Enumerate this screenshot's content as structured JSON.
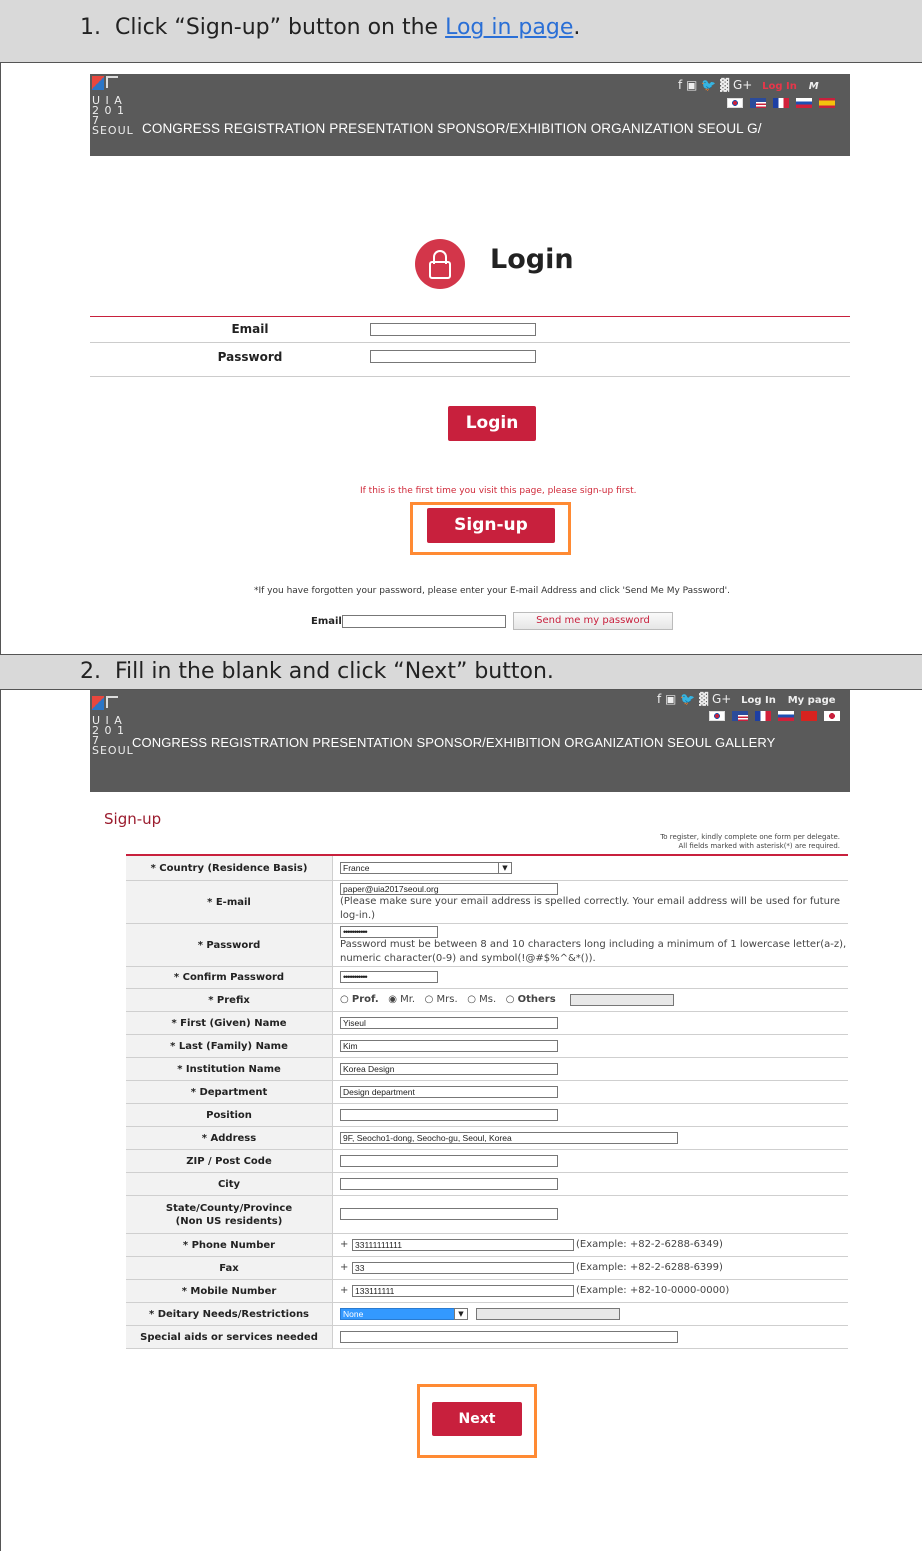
{
  "step1": {
    "number": "1.",
    "text": "Click “Sign-up” button on the ",
    "link": "Log in page",
    "end": "."
  },
  "step2": {
    "number": "2.",
    "text": "Fill in the blank and click “Next” button."
  },
  "site": {
    "logo_line1": "U I A",
    "logo_line2": "2 0 1 7",
    "logo_line3": "SEOUL",
    "nav1": "CONGRESS  REGISTRATION  PRESENTATION  SPONSOR/EXHIBITION  ORGANIZATION  SEOUL  G/",
    "nav2": "CONGRESS  REGISTRATION  PRESENTATION  SPONSOR/EXHIBITION  ORGANIZATION  SEOUL  GALLERY",
    "social1": "f  ▣  🐦  ▓  G+",
    "login_link1": "Log In",
    "mypage_trunc": "M",
    "social2": "f  ▣  🐦  ▓  G+",
    "login_link2": "Log In",
    "mypage2": "My page"
  },
  "login": {
    "title": "Login",
    "email_label": "Email",
    "password_label": "Password",
    "login_button": "Login",
    "first_time_note": "If this is the first time you visit this page, please sign-up first.",
    "signup_button": "Sign-up",
    "forgot_note": "*If you have forgotten your password, please enter your E-mail Address and click 'Send Me My Password'.",
    "forgot_email_label": "Email",
    "send_button": "Send me my password"
  },
  "signup": {
    "title": "Sign-up",
    "note1": "To register, kindly complete one form per delegate.",
    "note2": "All fields marked with asterisk(*) are required.",
    "rows": {
      "country": {
        "label": "* Country (Residence Basis)",
        "value": "France"
      },
      "email": {
        "label": "* E-mail",
        "value": "paper@uia2017seoul.org",
        "help": "(Please make sure your email address is spelled correctly. Your email address will be used for future log-in.)"
      },
      "password": {
        "label": "* Password",
        "value": "•••••••••••",
        "help": "Password must be between 8 and 10 characters long including a minimum of 1 lowercase letter(a-z), numeric character(0-9) and symbol(!@#$%^&*())."
      },
      "confirm": {
        "label": "* Confirm Password",
        "value": "•••••••••••"
      },
      "prefix": {
        "label": "* Prefix",
        "options": [
          "Prof.",
          "Mr.",
          "Mrs.",
          "Ms.",
          "Others"
        ],
        "selected": "Mr."
      },
      "first": {
        "label": "* First (Given) Name",
        "value": "Yiseul"
      },
      "last": {
        "label": "* Last (Family) Name",
        "value": "Kim"
      },
      "institution": {
        "label": "* Institution Name",
        "value": "Korea Design"
      },
      "department": {
        "label": "* Department",
        "value": "Design department"
      },
      "position": {
        "label": "Position",
        "value": ""
      },
      "address": {
        "label": "* Address",
        "value": "9F, Seocho1-dong, Seocho-gu, Seoul, Korea"
      },
      "zip": {
        "label": "ZIP / Post Code",
        "value": ""
      },
      "city": {
        "label": "City",
        "value": ""
      },
      "state": {
        "label1": "State/County/Province",
        "label2": "(Non US residents)",
        "value": ""
      },
      "phone": {
        "label": "* Phone Number",
        "prefix": "+",
        "value": "33111111111",
        "example": "(Example: +82-2-6288-6349)"
      },
      "fax": {
        "label": "Fax",
        "prefix": "+",
        "value": "33",
        "example": "(Example: +82-2-6288-6399)"
      },
      "mobile": {
        "label": "* Mobile Number",
        "prefix": "+",
        "value": "133111111",
        "example": "(Example: +82-10-0000-0000)"
      },
      "dietary": {
        "label": "* Deitary Needs/Restrictions",
        "value": "None"
      },
      "special": {
        "label": "Special aids or services needed",
        "value": ""
      }
    },
    "next_button": "Next"
  },
  "colors": {
    "accent_red": "#c8203d",
    "highlight_orange": "#ff8a33",
    "header_gray": "#5a5a5a",
    "step_gray": "#d9d9d9",
    "link_blue": "#2a6fd6"
  }
}
